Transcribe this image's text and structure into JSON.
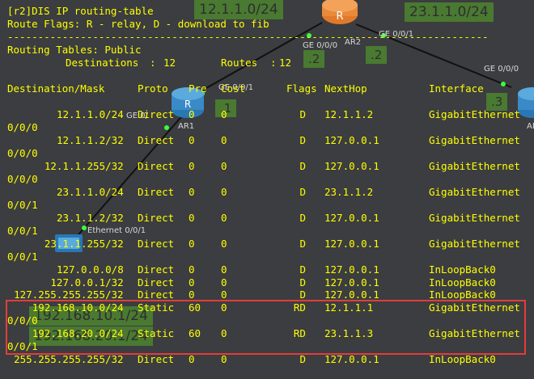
{
  "terminal": {
    "prompt": "[r2]DIS IP routing-table",
    "flags_line": "Route Flags: R - relay, D - download to fib",
    "separator": "-------------------------------------------------------------------------------",
    "tables_line": "Routing Tables: Public",
    "destinations_label": "Destinations",
    "destinations_count": "12",
    "routes_label": "Routes",
    "routes_count": "12",
    "headers": [
      "Destination/Mask",
      "Proto",
      "Pre",
      "Cost",
      "Flags",
      "NextHop",
      "Interface"
    ],
    "rows": [
      {
        "dest": "12.1.1.0/24",
        "proto": "Direct",
        "pre": "0",
        "cost": "0",
        "flags": "D",
        "nexthop": "12.1.1.2",
        "iface": "GigabitEthernet",
        "wrap": "0/0/0"
      },
      {
        "dest": "12.1.1.2/32",
        "proto": "Direct",
        "pre": "0",
        "cost": "0",
        "flags": "D",
        "nexthop": "127.0.0.1",
        "iface": "GigabitEthernet",
        "wrap": "0/0/0"
      },
      {
        "dest": "12.1.1.255/32",
        "proto": "Direct",
        "pre": "0",
        "cost": "0",
        "flags": "D",
        "nexthop": "127.0.0.1",
        "iface": "GigabitEthernet",
        "wrap": "0/0/0"
      },
      {
        "dest": "23.1.1.0/24",
        "proto": "Direct",
        "pre": "0",
        "cost": "0",
        "flags": "D",
        "nexthop": "23.1.1.2",
        "iface": "GigabitEthernet",
        "wrap": "0/0/1"
      },
      {
        "dest": "23.1.1.2/32",
        "proto": "Direct",
        "pre": "0",
        "cost": "0",
        "flags": "D",
        "nexthop": "127.0.0.1",
        "iface": "GigabitEthernet",
        "wrap": "0/0/1"
      },
      {
        "dest": "23.1.1.255/32",
        "proto": "Direct",
        "pre": "0",
        "cost": "0",
        "flags": "D",
        "nexthop": "127.0.0.1",
        "iface": "GigabitEthernet",
        "wrap": "0/0/1"
      },
      {
        "dest": "127.0.0.0/8",
        "proto": "Direct",
        "pre": "0",
        "cost": "0",
        "flags": "D",
        "nexthop": "127.0.0.1",
        "iface": "InLoopBack0",
        "wrap": ""
      },
      {
        "dest": "127.0.0.1/32",
        "proto": "Direct",
        "pre": "0",
        "cost": "0",
        "flags": "D",
        "nexthop": "127.0.0.1",
        "iface": "InLoopBack0",
        "wrap": ""
      },
      {
        "dest": "127.255.255.255/32",
        "proto": "Direct",
        "pre": "0",
        "cost": "0",
        "flags": "D",
        "nexthop": "127.0.0.1",
        "iface": "InLoopBack0",
        "wrap": ""
      },
      {
        "dest": "192.168.10.0/24",
        "proto": "Static",
        "pre": "60",
        "cost": "0",
        "flags": "RD",
        "nexthop": "12.1.1.1",
        "iface": "GigabitEthernet",
        "wrap": "0/0/0"
      },
      {
        "dest": "192.168.20.0/24",
        "proto": "Static",
        "pre": "60",
        "cost": "0",
        "flags": "RD",
        "nexthop": "23.1.1.3",
        "iface": "GigabitEthernet",
        "wrap": "0/0/1"
      },
      {
        "dest": "255.255.255.255/32",
        "proto": "Direct",
        "pre": "0",
        "cost": "0",
        "flags": "D",
        "nexthop": "127.0.0.1",
        "iface": "InLoopBack0",
        "wrap": ""
      }
    ]
  },
  "topology": {
    "net_boxes": [
      "12.1.1.0/24",
      "23.1.1.0/24",
      "192.168.10.1/24",
      "192.168.20.1/24"
    ],
    "addr_boxes": [
      ".2",
      ".2",
      ".1",
      ".3"
    ],
    "device_labels": [
      "AR2",
      "AR1",
      "AR"
    ],
    "iface_labels": [
      "GE 0/0/0",
      "GE 0/0/1",
      "GE 0/0/0",
      "GE 0/0/1",
      "GE 0/",
      "Ethernet 0/0/1"
    ],
    "router_glyph": "R",
    "highlight_color": "#e53c3c",
    "text_color": "#ffff00"
  }
}
